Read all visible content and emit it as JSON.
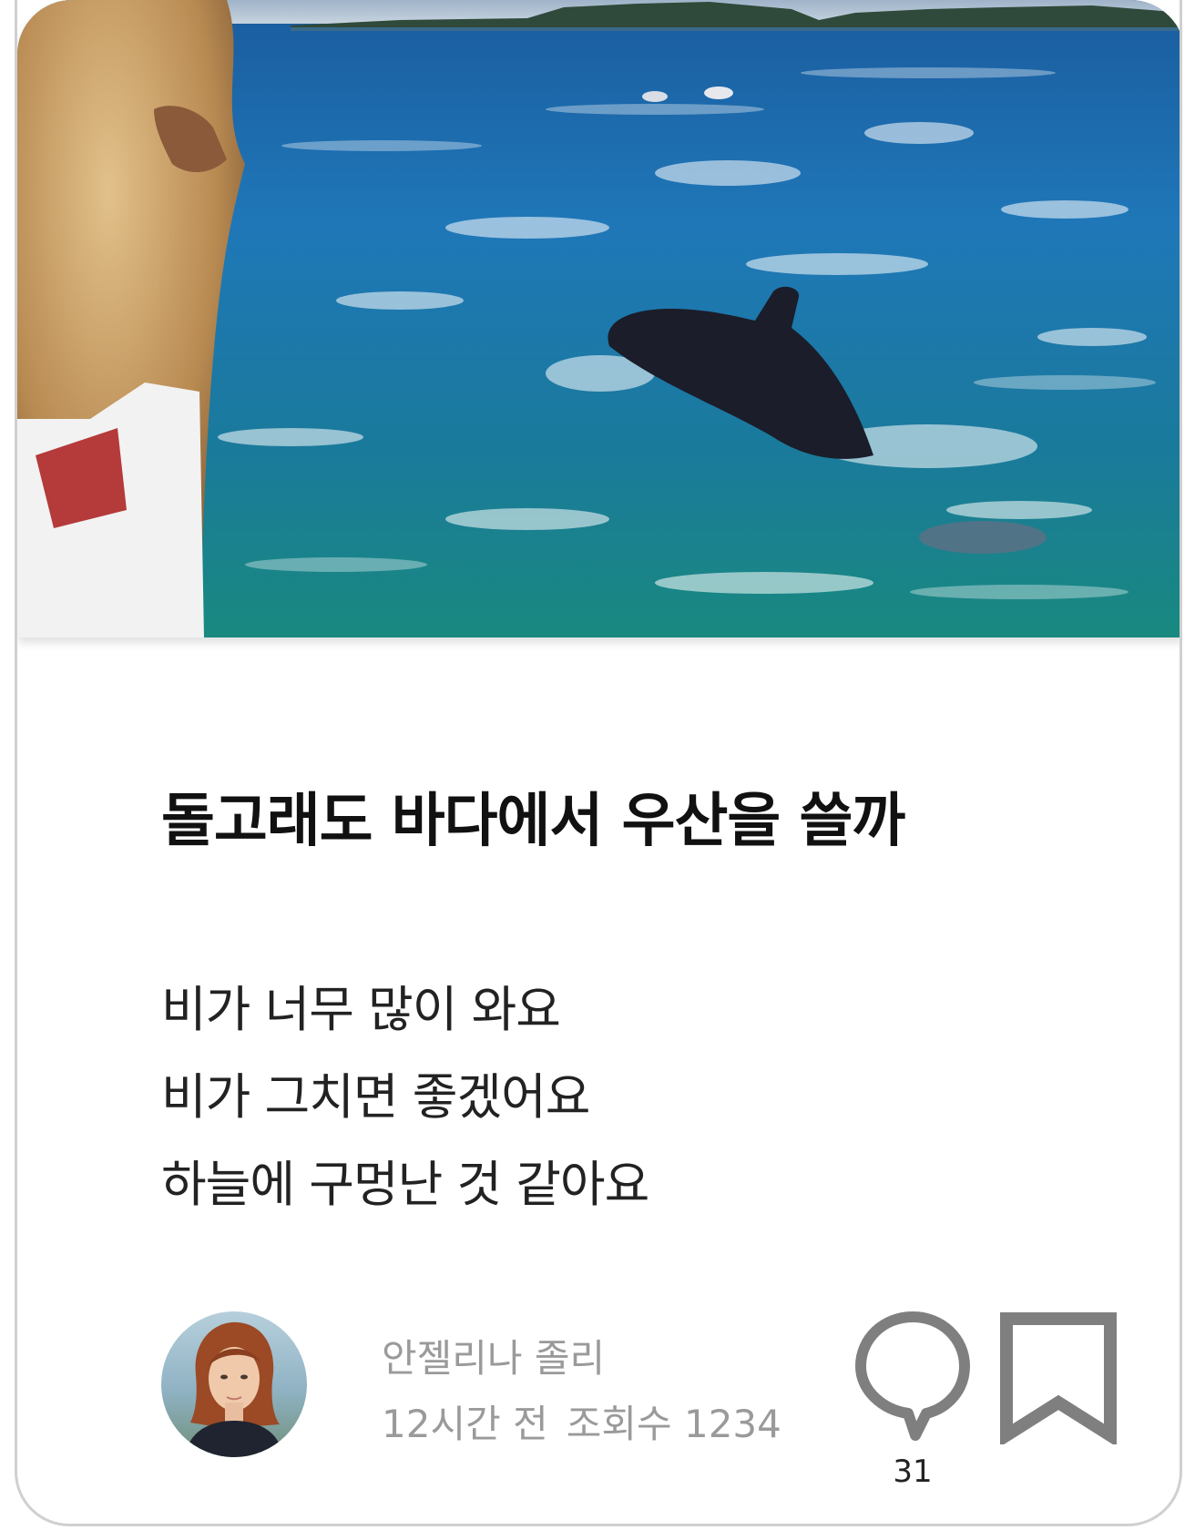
{
  "post": {
    "title": "돌고래도 바다에서 우산을 쓸까",
    "body_lines": [
      "비가 너무 많이 와요",
      "비가 그치면 좋겠어요",
      "하늘에 구멍난 것 같아요"
    ],
    "author": {
      "name": "안젤리나 졸리",
      "avatar": "avatar-photo"
    },
    "time_ago": "12시간 전",
    "views": "조회수 1234",
    "comment_count": "31"
  },
  "icons": {
    "comment": "comment-bubble-icon",
    "bookmark": "bookmark-icon"
  },
  "colors": {
    "icon_gray": "#7f7f7f",
    "meta_gray": "#9a9a9a",
    "title": "#111111",
    "card_border": "#d0d0d0"
  }
}
